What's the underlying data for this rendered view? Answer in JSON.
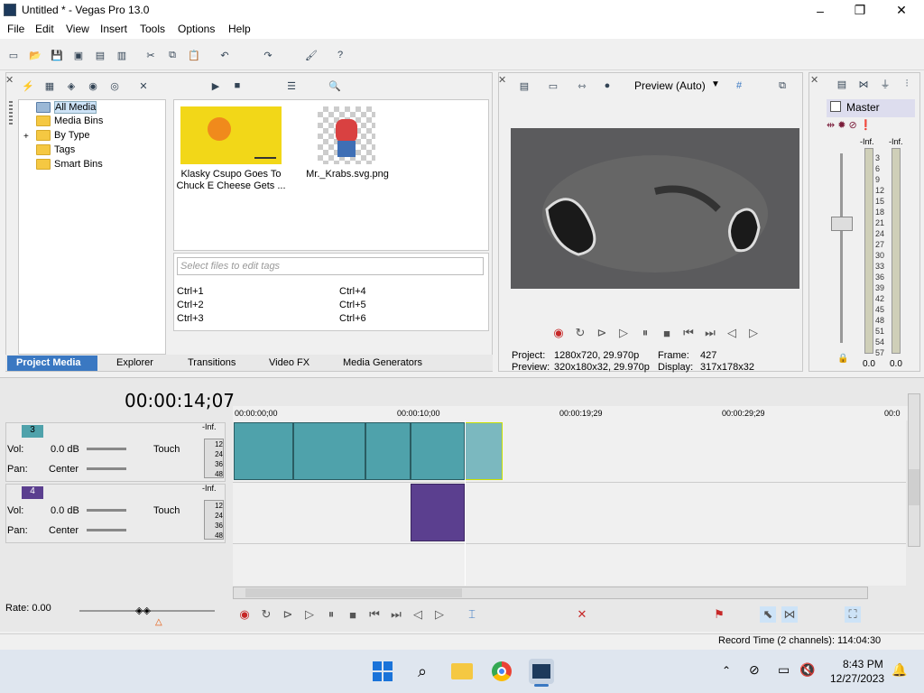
{
  "window": {
    "title": "Untitled * - Vegas Pro 13.0",
    "controls": {
      "minimize": "–",
      "restore": "❐",
      "close": "✕"
    }
  },
  "menu": [
    "File",
    "Edit",
    "View",
    "Insert",
    "Tools",
    "Options",
    "Help"
  ],
  "project_media": {
    "tree": [
      "All Media",
      "Media Bins",
      "By Type",
      "Tags",
      "Smart Bins"
    ],
    "tree_expander": "+",
    "files": [
      {
        "name": "Klasky Csupo Goes To Chuck E Cheese Gets ..."
      },
      {
        "name": "Mr._Krabs.svg.png"
      }
    ],
    "tag_placeholder": "Select files to edit tags",
    "shortcuts": [
      "Ctrl+1",
      "Ctrl+2",
      "Ctrl+3",
      "Ctrl+4",
      "Ctrl+5",
      "Ctrl+6"
    ],
    "tabs": [
      "Project Media",
      "Explorer",
      "Transitions",
      "Video FX",
      "Media Generators"
    ]
  },
  "preview": {
    "mode": "Preview (Auto)",
    "project_label": "Project:",
    "project_value": "1280x720, 29.970p",
    "preview_label": "Preview:",
    "preview_value": "320x180x32, 29.970p",
    "frame_label": "Frame:",
    "frame_value": "427",
    "display_label": "Display:",
    "display_value": "317x178x32"
  },
  "master": {
    "label": "Master",
    "inf_left": "-Inf.",
    "inf_right": "-Inf.",
    "scale": [
      "3",
      "6",
      "9",
      "12",
      "15",
      "18",
      "21",
      "24",
      "27",
      "30",
      "33",
      "36",
      "39",
      "42",
      "45",
      "48",
      "51",
      "54",
      "57"
    ],
    "values": [
      "0.0",
      "0.0"
    ]
  },
  "timeline": {
    "timecode": "00:00:14;07",
    "ruler": [
      "00:00:00;00",
      "00:00:10;00",
      "00:00:19;29",
      "00:00:29;29",
      "00:0"
    ],
    "tracks": [
      {
        "number": "3",
        "vol_label": "Vol:",
        "vol": "0.0 dB",
        "pan_label": "Pan:",
        "pan": "Center",
        "mode": "Touch",
        "inf": "-Inf.",
        "meter": [
          "12",
          "24",
          "36",
          "48"
        ]
      },
      {
        "number": "4",
        "vol_label": "Vol:",
        "vol": "0.0 dB",
        "pan_label": "Pan:",
        "pan": "Center",
        "mode": "Touch",
        "inf": "-Inf.",
        "meter": [
          "12",
          "24",
          "36",
          "48"
        ]
      }
    ],
    "rate": "Rate: 0.00"
  },
  "status": {
    "record_time": "Record Time (2 channels): 114:04:30"
  },
  "taskbar": {
    "time": "8:43 PM",
    "date": "12/27/2023"
  },
  "colors": {
    "accent": "#3a78c2",
    "track_video": "#4fa2ab",
    "track_purple": "#5b3f8f",
    "cursor_line": "#ffffff"
  }
}
